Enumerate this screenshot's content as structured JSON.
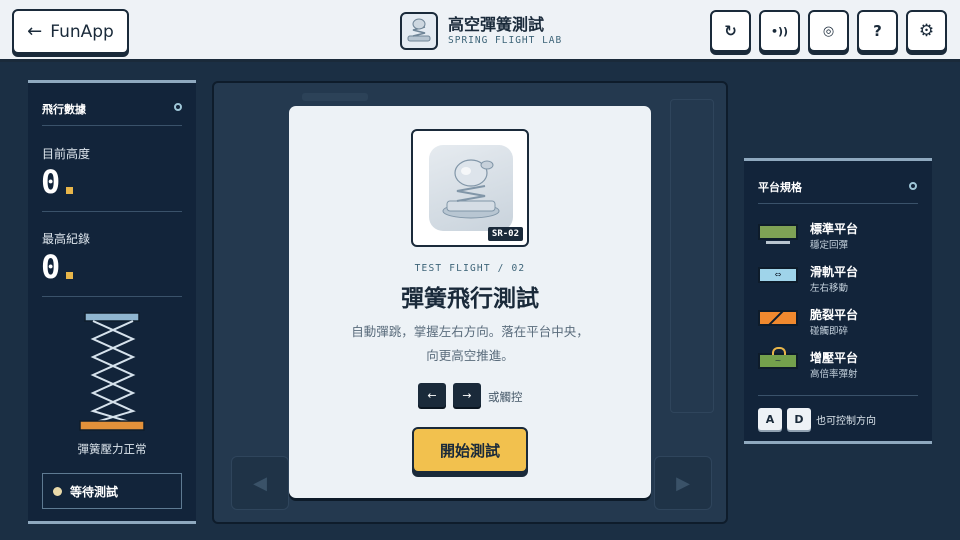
{
  "header": {
    "back_label": "FunApp",
    "title": "高空彈簧測試",
    "subtitle": "SPRING FLIGHT LAB",
    "tools": [
      {
        "name": "restart-icon",
        "glyph": "↻"
      },
      {
        "name": "sound-icon",
        "glyph": "•))"
      },
      {
        "name": "target-icon",
        "glyph": "◎"
      },
      {
        "name": "help-icon",
        "glyph": "?"
      },
      {
        "name": "settings-icon",
        "glyph": "⚙"
      }
    ]
  },
  "flight_data": {
    "heading": "飛行數據",
    "current_height_label": "目前高度",
    "current_height_value": "0",
    "best_record_label": "最高紀錄",
    "best_record_value": "0",
    "spring_status": "彈簧壓力正常",
    "game_status": "等待測試"
  },
  "modal": {
    "badge": "SR-02",
    "kicker": "TEST FLIGHT / 02",
    "title": "彈簧飛行測試",
    "desc_line1": "自動彈跳，掌握左右方向。落在平台中央，",
    "desc_line2": "向更高空推進。",
    "left_key": "←",
    "right_key": "→",
    "touch_label": "或觸控",
    "start_label": "開始測試"
  },
  "platforms": {
    "heading": "平台規格",
    "items": [
      {
        "name": "標準平台",
        "desc": "穩定回彈",
        "color": "#7fa255"
      },
      {
        "name": "滑軌平台",
        "desc": "左右移動",
        "color": "#9fd4ea"
      },
      {
        "name": "脆裂平台",
        "desc": "碰觸即碎",
        "color": "#f0892e"
      },
      {
        "name": "增壓平台",
        "desc": "高倍率彈射",
        "color": "#74a14c"
      }
    ],
    "key_a": "A",
    "key_d": "D",
    "key_hint": "也可控制方向"
  },
  "colors": {
    "accent": "#f2c14e",
    "panel": "#12243a",
    "page": "#1b2f44"
  }
}
